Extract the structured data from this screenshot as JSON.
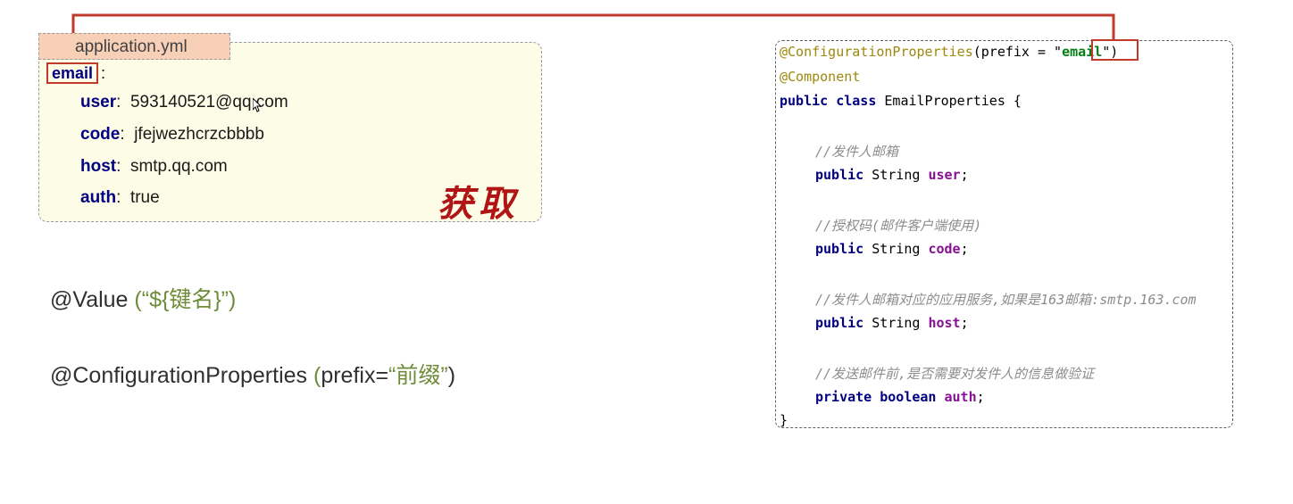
{
  "yaml": {
    "filename": "application.yml",
    "root_key": "email",
    "root_colon": ":",
    "entries": [
      {
        "key": "user",
        "value": "593140521@qq.com"
      },
      {
        "key": "code",
        "value": "jfejwezhcrzcbbbb"
      },
      {
        "key": "host",
        "value": "smtp.qq.com"
      },
      {
        "key": "auth",
        "value": "true"
      }
    ],
    "stamp": "获取"
  },
  "notes": {
    "value_prefix": "@Value ",
    "value_arg": "(“${键名}”)",
    "cp_prefix": "@ConfigurationProperties ",
    "cp_paren_open": "(",
    "cp_arg_name": "prefix=",
    "cp_arg_value": "“前缀”",
    "cp_paren_close": ")"
  },
  "code": {
    "l1_ann": "@ConfigurationProperties",
    "l1_mid": "(prefix = \"",
    "l1_str": "email",
    "l1_end": "\")",
    "l2_ann": "@Component",
    "l3_kw": "public class",
    "l3_name": " EmailProperties {",
    "c1": "//发件人邮箱",
    "f1_kw": "public",
    "f1_type": " String ",
    "f1_name": "user",
    "f1_end": ";",
    "c2": "//授权码(邮件客户端使用)",
    "f2_kw": "public",
    "f2_type": " String ",
    "f2_name": "code",
    "f2_end": ";",
    "c3": "//发件人邮箱对应的应用服务,如果是163邮箱:smtp.163.com",
    "f3_kw": "public",
    "f3_type": " String ",
    "f3_name": "host",
    "f3_end": ";",
    "c4": "//发送邮件前,是否需要对发件人的信息做验证",
    "f4_kw": "private boolean",
    "f4_name": " auth",
    "f4_end": ";",
    "close": "}"
  },
  "colors": {
    "connector": "#c0392b",
    "annotation_green": "#6f8c3a",
    "stamp_red": "#b01414"
  }
}
